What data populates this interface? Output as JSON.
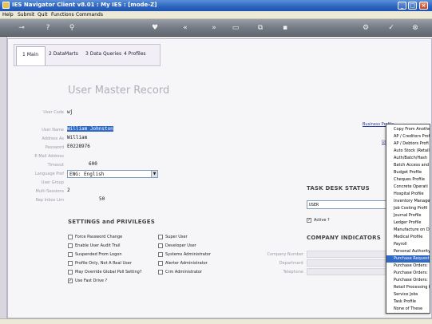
{
  "window": {
    "title": "IES Navigator Client v8.01 : My IES :      [mode-Z]"
  },
  "menu": [
    "Help",
    "Submit",
    "Quit",
    "Functions",
    "Commands"
  ],
  "toolbar_icons": [
    "key-icon",
    "help-icon",
    "search-icon",
    "heart-icon",
    "rewind-icon",
    "fast-forward-icon",
    "print-icon",
    "copy-icon",
    "lock-icon",
    "check-icon",
    "close-icon"
  ],
  "tabs": [
    "1 Main",
    "2 DataMarts",
    "3 Data Queries",
    "4 Profiles"
  ],
  "page": {
    "heading": "User Master Record"
  },
  "fields": {
    "user_code": {
      "label": "User Code",
      "value": "wj"
    },
    "user_name": {
      "label": "User Name",
      "value": "William Johnston"
    },
    "address_as": {
      "label": "Address As",
      "value": "William"
    },
    "password": {
      "label": "Password",
      "value": "E0228976"
    },
    "email": {
      "label": "E-Mail Address",
      "value": ""
    },
    "timeout": {
      "label": "Timeout",
      "value": "600"
    },
    "language": {
      "label": "Language Pref",
      "value": "ENG: English"
    },
    "user_group": {
      "label": "User Group",
      "value": ""
    },
    "multi_sessions": {
      "label": "Multi Sessions",
      "value": "2"
    },
    "rep_inbox": {
      "label": "Rep Inbox Lim",
      "value": "50"
    }
  },
  "settings": {
    "title": "SETTINGS and PRIVILEGES",
    "items": [
      {
        "label": "Force Password Change",
        "checked": false
      },
      {
        "label": "Enable User Audit Trail",
        "checked": false
      },
      {
        "label": "Suspended From Logon",
        "checked": false
      },
      {
        "label": "Profile Only, Not A Real User",
        "checked": false
      },
      {
        "label": "May Override Global Poll Setting?",
        "checked": false
      },
      {
        "label": "Use Fast Drive ?",
        "checked": true
      },
      {
        "label": "Super User",
        "checked": false
      },
      {
        "label": "Developer User",
        "checked": false
      },
      {
        "label": "Systems Administrator",
        "checked": false
      },
      {
        "label": "Alerter Administrator",
        "checked": false
      },
      {
        "label": "Crm Administrator",
        "checked": false
      }
    ]
  },
  "task_desk": {
    "title": "TASK DESK STATUS",
    "value": "USER",
    "active_label": "Active ?",
    "active": true
  },
  "company": {
    "title": "COMPANY INDICATORS",
    "labels": [
      "Company Number",
      "Department",
      "Telephone"
    ]
  },
  "links": {
    "business_profile": "Business Profile",
    "partial": "Us"
  },
  "dropdown": {
    "items": [
      "Copy From Another",
      "AP / Creditors Prof",
      "AP / Debtors Profi",
      "Auto Stock (Retail",
      "Auth/Batch/Hash",
      "Batch Access and",
      "Budget Profile",
      "Cheques Profile",
      "Concrete Operati",
      "Hospital Profile",
      "Inventory Manage",
      "Job Costing Profil",
      "Journal Profile",
      "Ledger Profile",
      "Manufacture on D",
      "Medical Profile",
      "Payroll",
      "Personal Authority",
      "Purchase Request",
      "Purchase Orders:",
      "Purchase Orders:",
      "Purchase Orders:",
      "Retail Processing P",
      "Service Jobs",
      "Task Profile",
      "None of These"
    ],
    "highlighted_index": 18
  }
}
